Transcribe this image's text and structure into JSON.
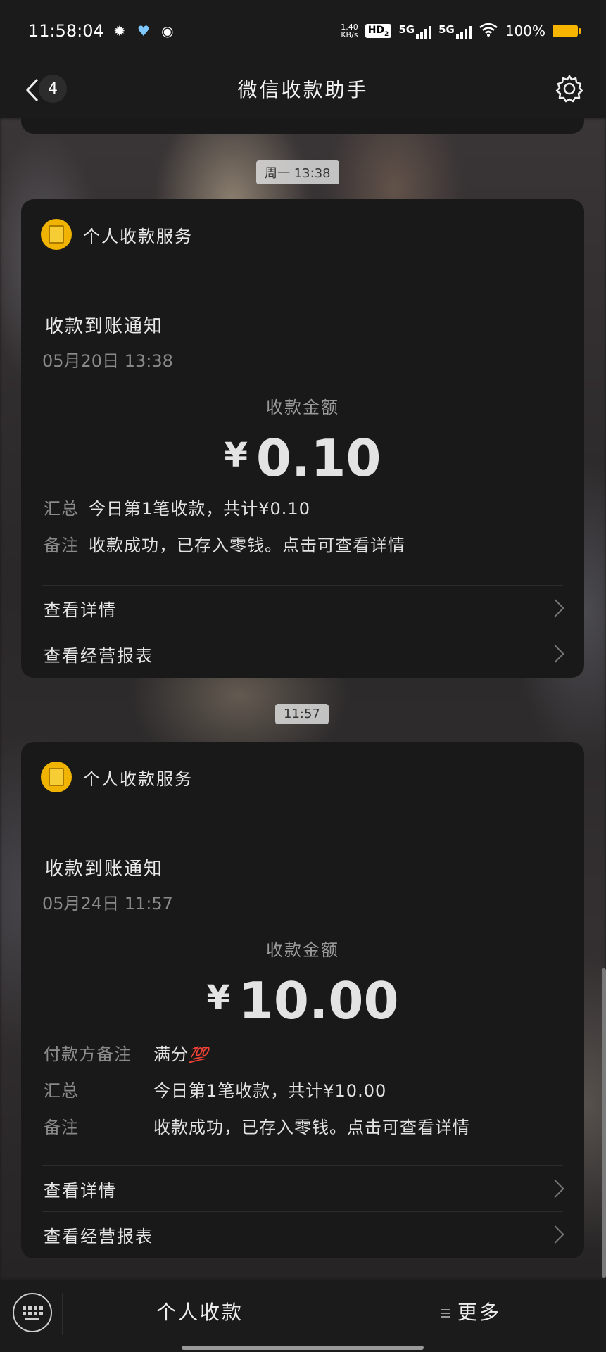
{
  "status_bar": {
    "time": "11:58:04",
    "net_speed_value": "1.40",
    "net_speed_unit": "KB/s",
    "hd_label": "HD",
    "hd_sub": "2",
    "sim1_label": "5G",
    "sim2_label": "5G",
    "battery_pct": "100%",
    "battery_color": "#f7b500"
  },
  "header": {
    "title": "微信收款助手",
    "unread_count": "4"
  },
  "messages": [
    {
      "time_chip": "周一 13:38",
      "service_name": "个人收款服务",
      "notice_title": "收款到账通知",
      "date": "05月20日  13:38",
      "amount_label": "收款金额",
      "currency": "¥",
      "amount": "0.10",
      "summary_key": "汇总",
      "summary_value": "今日第1笔收款，共计¥0.10",
      "remark_key": "备注",
      "remark_value": "收款成功，已存入零钱。点击可查看详情",
      "link_details": "查看详情",
      "link_report": "查看经营报表"
    },
    {
      "time_chip": "11:57",
      "service_name": "个人收款服务",
      "notice_title": "收款到账通知",
      "date": "05月24日  11:57",
      "amount_label": "收款金额",
      "currency": "¥",
      "amount": "10.00",
      "payer_note_key": "付款方备注",
      "payer_note_value": "满分",
      "payer_note_emoji": "💯",
      "summary_key": "汇总",
      "summary_value": "今日第1笔收款，共计¥10.00",
      "remark_key": "备注",
      "remark_value": "收款成功，已存入零钱。点击可查看详情",
      "link_details": "查看详情",
      "link_report": "查看经营报表"
    }
  ],
  "bottom_bar": {
    "keyboard_icon": "keyboard-icon",
    "menu_personal": "个人收款",
    "menu_more": "更多"
  }
}
